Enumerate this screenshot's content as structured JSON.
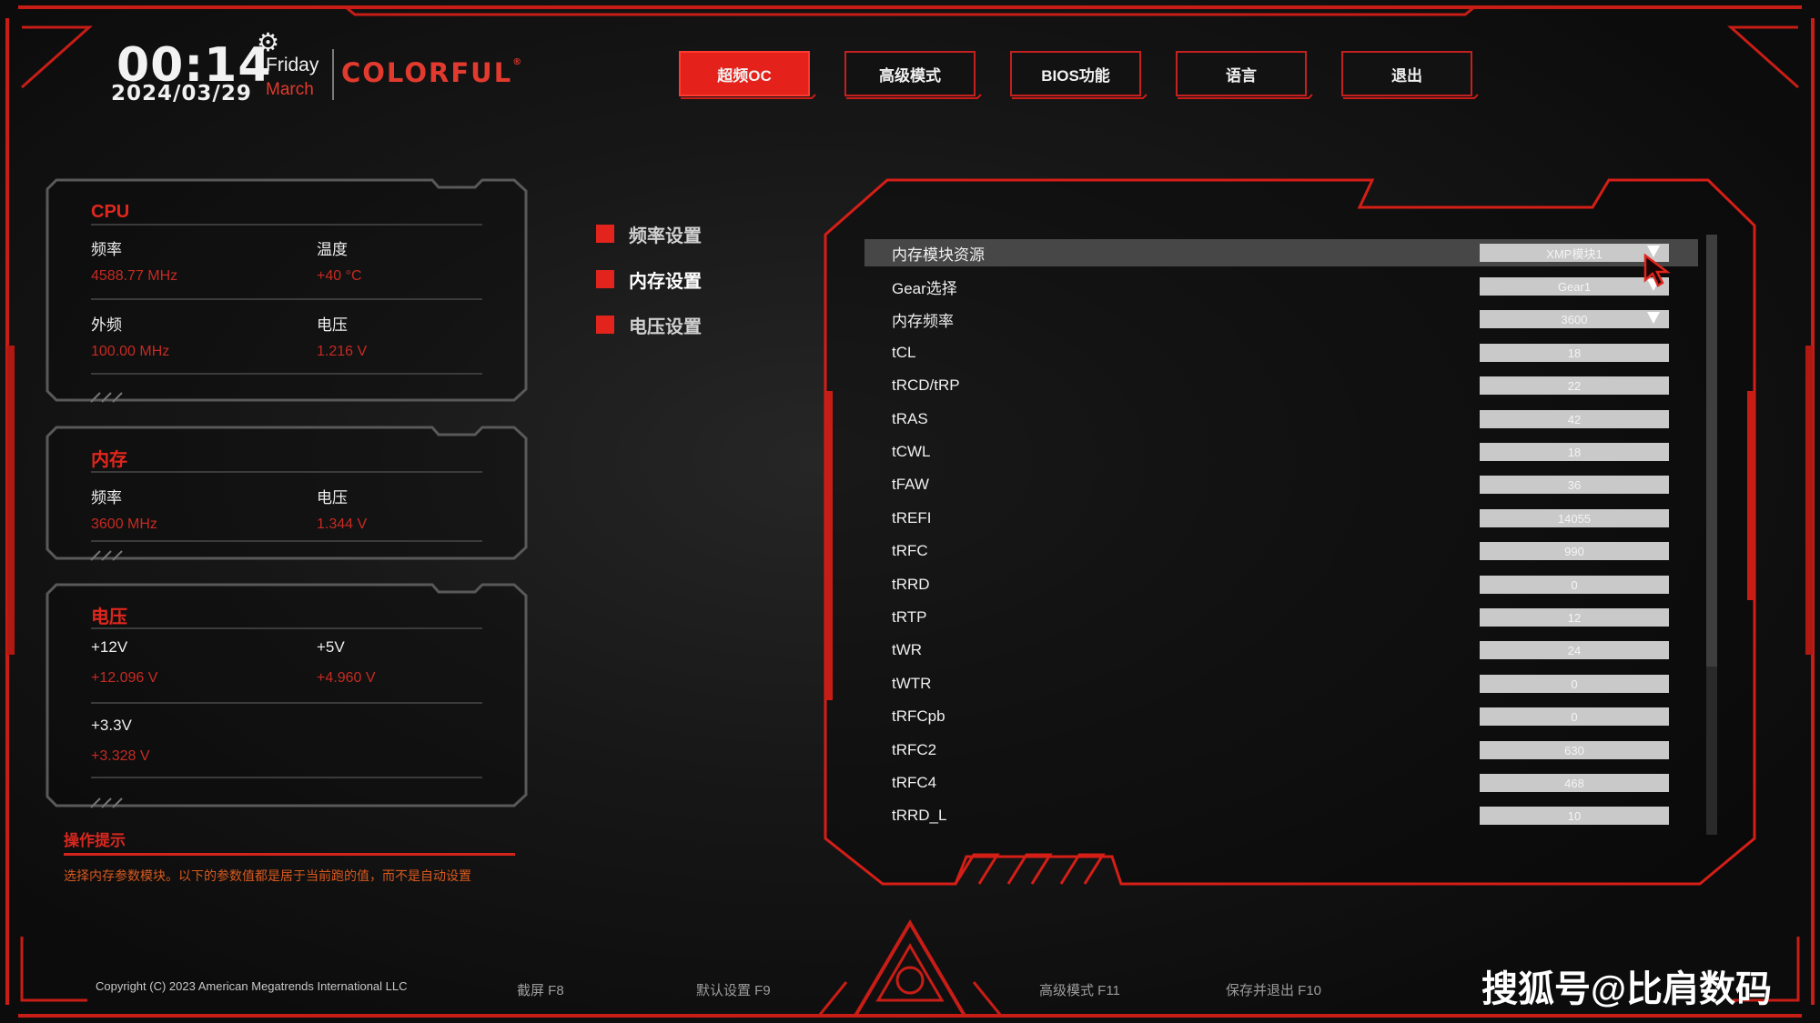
{
  "header": {
    "time": "00:14",
    "date": "2024/03/29",
    "weekday": "Friday",
    "month": "March",
    "brand": "COLORFUL",
    "brand_mark": "®",
    "gear_icon": "⚙"
  },
  "tabs": [
    {
      "label": "超频OC",
      "active": true
    },
    {
      "label": "高级模式"
    },
    {
      "label": "BIOS功能"
    },
    {
      "label": "语言"
    },
    {
      "label": "退出"
    }
  ],
  "cpu_panel": {
    "title": "CPU",
    "freq_label": "频率",
    "freq_value": "4588.77 MHz",
    "temp_label": "温度",
    "temp_value": "+40 °C",
    "bclk_label": "外频",
    "bclk_value": "100.00 MHz",
    "volt_label": "电压",
    "volt_value": "1.216 V"
  },
  "mem_panel": {
    "title": "内存",
    "freq_label": "频率",
    "freq_value": "3600 MHz",
    "volt_label": "电压",
    "volt_value": "1.344 V"
  },
  "volt_panel": {
    "title": "电压",
    "v12_label": "+12V",
    "v12_value": "+12.096 V",
    "v5_label": "+5V",
    "v5_value": "+4.960 V",
    "v33_label": "+3.3V",
    "v33_value": "+3.328 V"
  },
  "menu": [
    {
      "label": "频率设置"
    },
    {
      "label": "内存设置",
      "active": true
    },
    {
      "label": "电压设置"
    }
  ],
  "settings": [
    {
      "name": "内存模块资源",
      "value": "XMP模块1",
      "dropdown": true,
      "selected": true
    },
    {
      "name": "Gear选择",
      "value": "Gear1",
      "dropdown": true
    },
    {
      "name": "内存频率",
      "value": "3600",
      "dropdown": true
    },
    {
      "name": "tCL",
      "value": "18"
    },
    {
      "name": "tRCD/tRP",
      "value": "22"
    },
    {
      "name": "tRAS",
      "value": "42"
    },
    {
      "name": "tCWL",
      "value": "18"
    },
    {
      "name": "tFAW",
      "value": "36"
    },
    {
      "name": "tREFI",
      "value": "14055"
    },
    {
      "name": "tRFC",
      "value": "990"
    },
    {
      "name": "tRRD",
      "value": "0"
    },
    {
      "name": "tRTP",
      "value": "12"
    },
    {
      "name": "tWR",
      "value": "24"
    },
    {
      "name": "tWTR",
      "value": "0"
    },
    {
      "name": "tRFCpb",
      "value": "0"
    },
    {
      "name": "tRFC2",
      "value": "630"
    },
    {
      "name": "tRFC4",
      "value": "468"
    },
    {
      "name": "tRRD_L",
      "value": "10"
    }
  ],
  "hint": {
    "title": "操作提示",
    "text": "选择内存参数模块。以下的参数值都是居于当前跑的值，而不是自动设置"
  },
  "footer": {
    "copyright": "Copyright (C) 2023 American Megatrends International LLC",
    "screenshot": "截屏 F8",
    "defaults": "默认设置 F9",
    "advanced": "高级模式 F11",
    "save_exit": "保存并退出 F10"
  },
  "watermark": "搜狐号@比肩数码",
  "colors": {
    "accent": "#e4221b",
    "panel_border": "#5a5a5a",
    "value_red": "#c62a22"
  }
}
